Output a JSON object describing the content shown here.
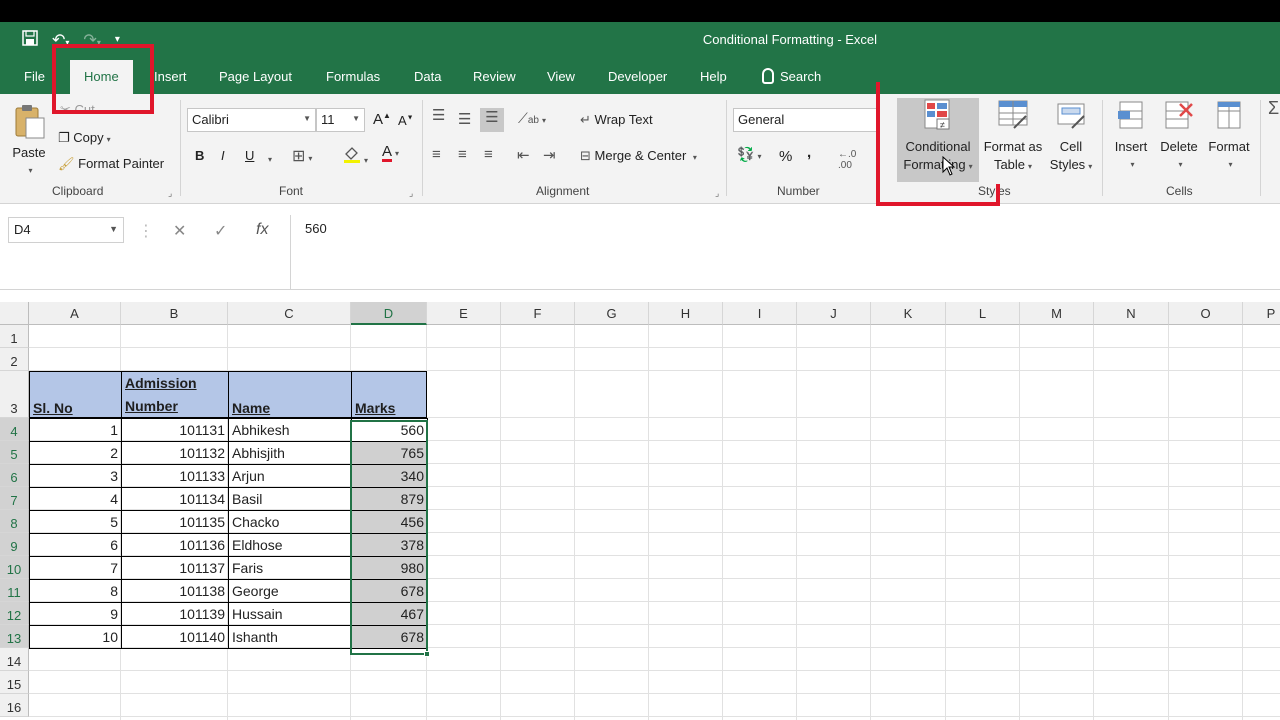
{
  "window": {
    "title": "Conditional Formatting  -  Excel"
  },
  "tabs": [
    "File",
    "Home",
    "Insert",
    "Page Layout",
    "Formulas",
    "Data",
    "Review",
    "View",
    "Developer",
    "Help",
    "Search"
  ],
  "ribbon": {
    "clipboard": {
      "paste": "Paste",
      "cut": "Cut",
      "copy": "Copy",
      "format_painter": "Format Painter",
      "label": "Clipboard"
    },
    "font": {
      "name": "Calibri",
      "size": "11",
      "bold": "B",
      "italic": "I",
      "underline": "U",
      "font_color": "A",
      "label": "Font"
    },
    "alignment": {
      "wrap_text": "Wrap Text",
      "merge_center": "Merge & Center",
      "label": "Alignment"
    },
    "number": {
      "format": "General",
      "percent": "%",
      "comma": ",",
      "label": "Number"
    },
    "styles": {
      "conditional_formatting": [
        "Conditional",
        "Formatting"
      ],
      "format_as_table": [
        "Format as",
        "Table"
      ],
      "cell_styles": [
        "Cell",
        "Styles"
      ],
      "label": "Styles"
    },
    "cells": {
      "insert": "Insert",
      "delete": "Delete",
      "format": "Format",
      "label": "Cells"
    }
  },
  "formula_bar": {
    "name_box": "D4",
    "value": "560",
    "fx": "fx"
  },
  "sheet": {
    "columns": [
      "A",
      "B",
      "C",
      "D",
      "E",
      "F",
      "G",
      "H",
      "I",
      "J",
      "K",
      "L",
      "M",
      "N",
      "O",
      "P"
    ],
    "rows": [
      "1",
      "2",
      "3",
      "4",
      "5",
      "6",
      "7",
      "8",
      "9",
      "10",
      "11",
      "12",
      "13",
      "14",
      "15",
      "16"
    ],
    "headers": {
      "sl_no": "Sl. No",
      "admission_1": "Admission",
      "admission_2": "Number",
      "name": "Name",
      "marks": "Marks"
    },
    "data": [
      {
        "sl": "1",
        "adm": "101131",
        "name": "Abhikesh",
        "marks": "560"
      },
      {
        "sl": "2",
        "adm": "101132",
        "name": "Abhisjith",
        "marks": "765"
      },
      {
        "sl": "3",
        "adm": "101133",
        "name": "Arjun",
        "marks": "340"
      },
      {
        "sl": "4",
        "adm": "101134",
        "name": "Basil",
        "marks": "879"
      },
      {
        "sl": "5",
        "adm": "101135",
        "name": "Chacko",
        "marks": "456"
      },
      {
        "sl": "6",
        "adm": "101136",
        "name": "Eldhose",
        "marks": "378"
      },
      {
        "sl": "7",
        "adm": "101137",
        "name": "Faris",
        "marks": "980"
      },
      {
        "sl": "8",
        "adm": "101138",
        "name": "George",
        "marks": "678"
      },
      {
        "sl": "9",
        "adm": "101139",
        "name": "Hussain",
        "marks": "467"
      },
      {
        "sl": "10",
        "adm": "101140",
        "name": "Ishanth",
        "marks": "678"
      }
    ]
  },
  "colors": {
    "excel_green": "#227447",
    "header_fill": "#b4c6e7",
    "highlight_red": "#e0162b"
  }
}
